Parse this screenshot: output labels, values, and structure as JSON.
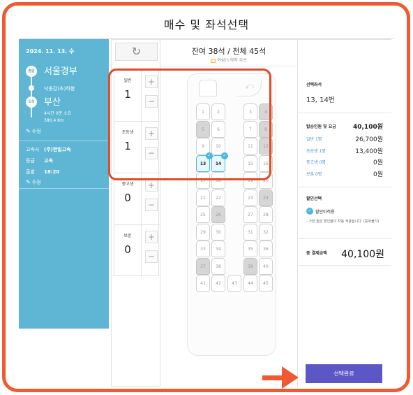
{
  "modal": {
    "title": "매수 및 좌석선택"
  },
  "trip": {
    "date": "2024. 11. 13. 수",
    "departure_badge": "출발",
    "arrival_badge": "도착",
    "departure": "서울경부",
    "via": "낙동강(초)하행",
    "arrival": "부산",
    "duration": "4시간 0분 소요",
    "distance": "380.4 Km",
    "edit_route": "수정",
    "operator_label": "고속사",
    "operator": "(주)한일고속",
    "grade_label": "등급",
    "grade": "고속",
    "time_label": "출발",
    "time": "18:20",
    "edit_time": "수정"
  },
  "controls": {
    "refresh_icon": "↻"
  },
  "passengers": [
    {
      "label": "일반",
      "count": "1",
      "plus": "+",
      "minus": "−"
    },
    {
      "label": "초등생",
      "count": "1",
      "plus": "+",
      "minus": "−"
    },
    {
      "label": "중고생",
      "count": "0",
      "plus": "+",
      "minus": "−"
    },
    {
      "label": "보훈",
      "count": "0",
      "plus": "+",
      "minus": "−"
    }
  ],
  "seat_map": {
    "remaining": "잔여 38석 / 전체 45석",
    "legend": "여성/노약자 우선",
    "taken": [
      "4",
      "5",
      "8",
      "12",
      "24",
      "26",
      "37",
      "39"
    ],
    "selected": [
      "13",
      "14"
    ],
    "check_icon": "✓",
    "door_icon": "⤺"
  },
  "summary": {
    "selected_seat_title": "선택좌석",
    "selected_seats": "13, 14번",
    "fare_title": "탑승인원 및 요금",
    "total_fare": "40,100원",
    "fares": [
      {
        "label": "일반 1명",
        "value": "26,700원"
      },
      {
        "label": "초등생 1명",
        "value": "13,400원"
      },
      {
        "label": "중고생 0명",
        "value": "0원"
      },
      {
        "label": "보훈 0명",
        "value": "0원"
      }
    ],
    "discount_title": "할인선택",
    "discount_option": "할인미적용",
    "discount_note": "- 가장 높은 할인율이 자동 적용됩니다. (중복불가)",
    "grand_total_label": "총 결제금액",
    "grand_total": "40,100원"
  },
  "actions": {
    "confirm": "선택완료"
  },
  "colors": {
    "sidebar": "#5eb6d4",
    "accent_highlight": "#f05a32",
    "confirm": "#5b57c6",
    "selected_seat": "#49b8dc"
  }
}
